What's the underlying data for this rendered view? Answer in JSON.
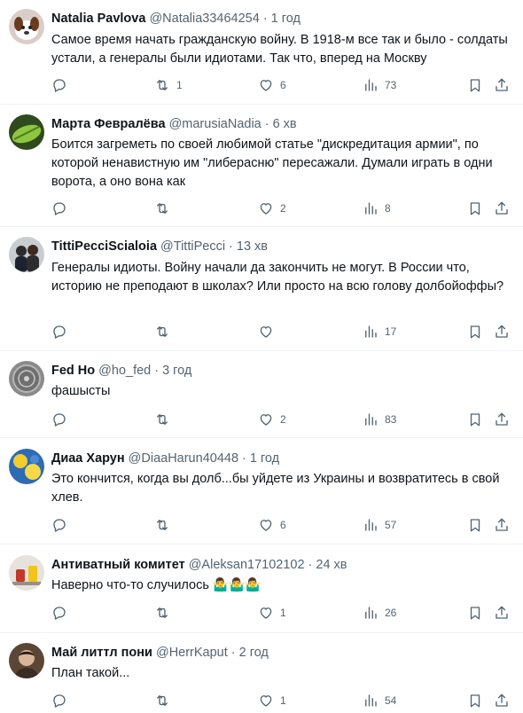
{
  "tweets": [
    {
      "name": "Natalia Pavlova",
      "handle": "@Natalia33464254",
      "time": "1 год",
      "text": "Самое время начать гражданскую войну. В 1918-м все так и было - солдаты устали, а генералы были идиотами. Так что, вперед на Москву",
      "replies": "",
      "retweets": "1",
      "likes": "6",
      "views": "73",
      "avatar_icon": "dog-photo"
    },
    {
      "name": "Марта Февралёва",
      "handle": "@marusiaNadia",
      "time": "6 хв",
      "text": "Боится загреметь по своей любимой статье \"дискредитация армии\", по которой ненавистную им \"либерасню\" пересажали. Думали играть в одни ворота, а оно вона как",
      "replies": "",
      "retweets": "",
      "likes": "2",
      "views": "8",
      "avatar_icon": "green-leaf-photo"
    },
    {
      "name": "TittiPecciScialoia",
      "handle": "@TittiPecci",
      "time": "13 хв",
      "text": "Генералы идиоты. Войну начали да закончить не могут. В России что, историю не преподают в школах? Или просто на всю голову долбойоффы?",
      "replies": "",
      "retweets": "",
      "likes": "",
      "views": "17",
      "avatar_icon": "two-people-photo"
    },
    {
      "name": "Fed Ho",
      "handle": "@ho_fed",
      "time": "3 год",
      "text": "фашысты",
      "replies": "",
      "retweets": "",
      "likes": "2",
      "views": "83",
      "avatar_icon": "grey-coin-photo"
    },
    {
      "name": "Диаа Харун",
      "handle": "@DiaaHarun40448",
      "time": "1 год",
      "text": "Это кончится, когда вы долб...бы уйдете из Украины и возвратитесь в свой хлев.",
      "replies": "",
      "retweets": "",
      "likes": "6",
      "views": "57",
      "avatar_icon": "blue-yellow-photo"
    },
    {
      "name": "Антиватный комитет",
      "handle": "@Aleksan17102102",
      "time": "24 хв",
      "text": "Наверно что-то случилось 🤷‍♂️🤷‍♂️🤷‍♂️",
      "replies": "",
      "retweets": "",
      "likes": "1",
      "views": "26",
      "avatar_icon": "cups-photo"
    },
    {
      "name": "Май литтл пони",
      "handle": "@HerrKaput",
      "time": "2 год",
      "text": "План такой...",
      "replies": "",
      "retweets": "",
      "likes": "1",
      "views": "54",
      "avatar_icon": "portrait-photo"
    }
  ],
  "icons": {
    "reply": "reply-icon",
    "retweet": "retweet-icon",
    "like": "heart-icon",
    "views": "views-chart-icon",
    "bookmark": "bookmark-icon",
    "share": "share-icon"
  },
  "colors": {
    "text": "#0f1419",
    "secondary": "#536471",
    "divider": "#eff3f4"
  }
}
